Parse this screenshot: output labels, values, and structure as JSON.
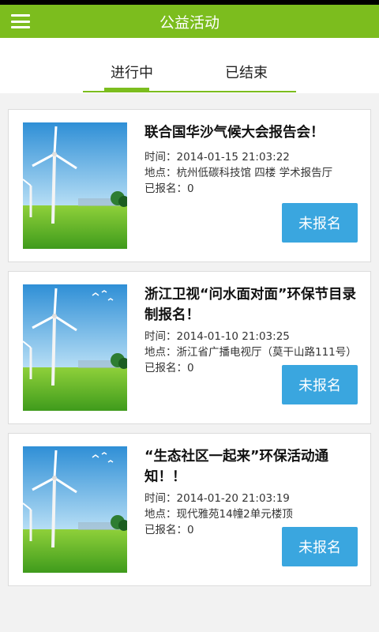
{
  "app": {
    "title": "公益活动"
  },
  "tabs": [
    {
      "label": "进行中",
      "active": true
    },
    {
      "label": "已结束",
      "active": false
    }
  ],
  "events": [
    {
      "title": "联合国华沙气候大会报告会！",
      "time": "时间：2014-01-15 21:03:22",
      "place": "地点：杭州低碳科技馆 四楼 学术报告厅",
      "signups": "已报名：0",
      "button": "未报名"
    },
    {
      "title": "浙江卫视“问水面对面”环保节目录制报名！",
      "time": "时间：2014-01-10 21:03:25",
      "place": "地点：浙江省广播电视厅（莫干山路111号）",
      "signups": "已报名：0",
      "button": "未报名"
    },
    {
      "title": "“生态社区一起来”环保活动通知！！",
      "time": "时间：2014-01-20 21:03:19",
      "place": "地点：现代雅苑14幢2单元楼顶",
      "signups": "已报名：0",
      "button": "未报名"
    }
  ],
  "colors": {
    "appbar": "#7cbd1e",
    "button": "#3aa6df",
    "tab_indicator": "#7cbd1e"
  },
  "icons": {
    "menu": "menu-icon",
    "thumbnail": "wind-turbine-image"
  }
}
